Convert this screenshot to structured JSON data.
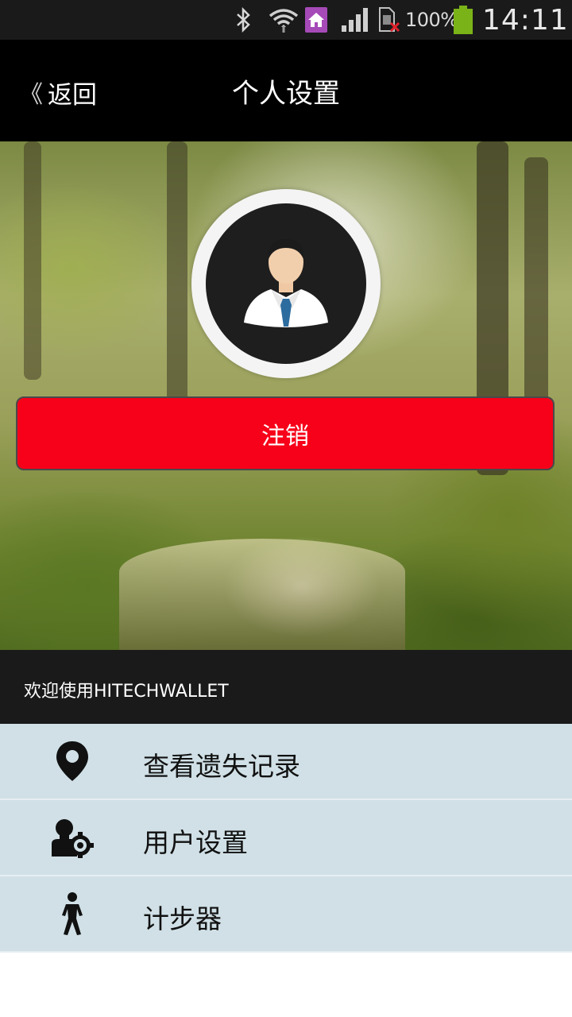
{
  "status_bar": {
    "battery_text": "100%",
    "time": "14:11",
    "icons": [
      "bluetooth-icon",
      "wifi-icon",
      "home-app-icon",
      "signal-icon",
      "sim-error-icon",
      "battery-icon"
    ],
    "battery_color": "#7ab317"
  },
  "header": {
    "back_chevron": "《",
    "back_label": "返回",
    "title": "个人设置"
  },
  "hero": {
    "avatar_icon": "user-avatar-icon",
    "logout_label": "注销",
    "logout_color": "#f70019"
  },
  "welcome": {
    "text": "欢迎使用HITECHWALLET"
  },
  "menu": {
    "items": [
      {
        "icon": "location-pin-icon",
        "label": "查看遗失记录"
      },
      {
        "icon": "user-settings-icon",
        "label": "用户设置"
      },
      {
        "icon": "walking-person-icon",
        "label": "计步器"
      }
    ],
    "background": "#d0e0e6"
  }
}
